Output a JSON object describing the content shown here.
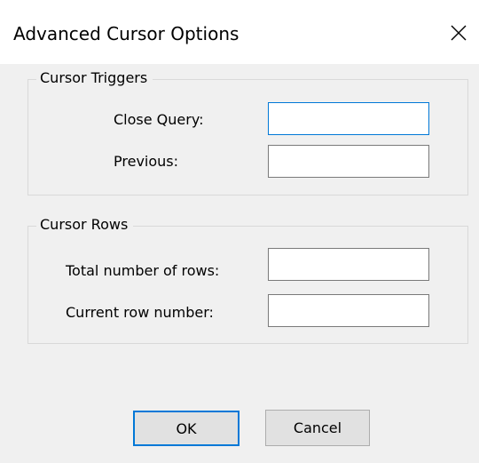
{
  "window": {
    "title": "Advanced Cursor Options",
    "close_icon": "close-icon"
  },
  "triggers": {
    "group_title": "Cursor Triggers",
    "close_query_label": "Close Query:",
    "close_query_value": "",
    "previous_label": "Previous:",
    "previous_value": ""
  },
  "rows": {
    "group_title": "Cursor Rows",
    "total_rows_label": "Total number of rows:",
    "total_rows_value": "",
    "current_row_label": "Current row number:",
    "current_row_value": ""
  },
  "buttons": {
    "ok_label": "OK",
    "cancel_label": "Cancel"
  },
  "colors": {
    "accent": "#0078d7",
    "dialog_bg": "#f0f0f0",
    "button_bg": "#e1e1e1"
  }
}
